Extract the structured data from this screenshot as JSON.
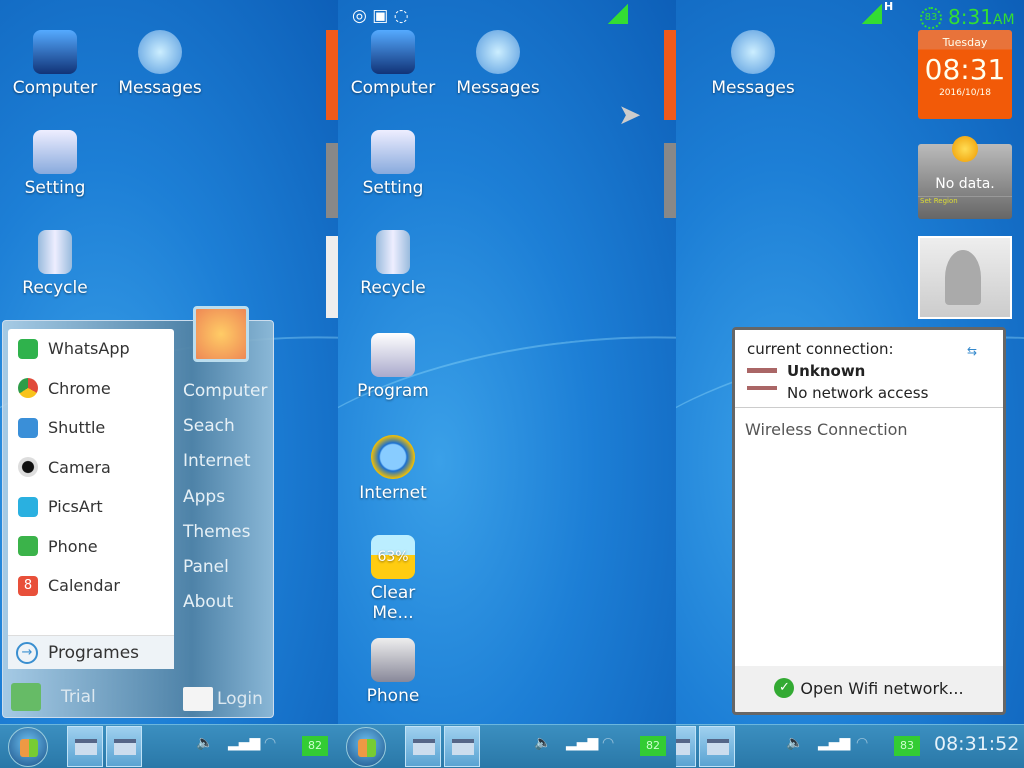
{
  "panel1": {
    "icons": [
      {
        "label": "Computer",
        "icon": "computer-icon"
      },
      {
        "label": "Messages",
        "icon": "chat-bubble-icon"
      },
      {
        "label": "Setting",
        "icon": "settings-icon"
      },
      {
        "label": "Recycle",
        "icon": "recycle-bin-icon"
      }
    ],
    "start_menu": {
      "apps": [
        {
          "label": "WhatsApp",
          "color": "#2fb24c"
        },
        {
          "label": "Chrome",
          "color": "#e04a3a"
        },
        {
          "label": "Shuttle",
          "color": "#3a8fd8"
        },
        {
          "label": "Camera",
          "color": "#333333"
        },
        {
          "label": "PicsArt",
          "color": "#2ab0e0"
        },
        {
          "label": "Phone",
          "color": "#3bb34a"
        },
        {
          "label": "Calendar",
          "color": "#e8503a"
        }
      ],
      "calendar_badge": "8",
      "programs": "Programes",
      "links": [
        "Computer",
        "Seach",
        "Internet",
        "Apps",
        "Themes",
        "Panel",
        "About"
      ],
      "user": "Trial",
      "login": "Login"
    }
  },
  "panel2": {
    "icons": [
      {
        "label": "Computer"
      },
      {
        "label": "Messages"
      },
      {
        "label": "Setting"
      },
      {
        "label": "Recycle"
      },
      {
        "label": "Program"
      },
      {
        "label": "Internet"
      },
      {
        "label": "Clear Me...",
        "badge": "63%"
      },
      {
        "label": "Phone"
      }
    ]
  },
  "panel3": {
    "status": {
      "network": "H",
      "battery": "83",
      "time": "8:31",
      "ampm": "AM"
    },
    "icons": [
      {
        "label": "Messages"
      }
    ],
    "clock_widget": {
      "day": "Tuesday",
      "time": "08:31",
      "date": "2016/10/18"
    },
    "weather_widget": {
      "text": "No data.",
      "link": "Set Region"
    },
    "connection": {
      "title": "current connection:",
      "name": "Unknown",
      "status": "No network access",
      "section": "Wireless Connection",
      "button": "Open Wifi network..."
    }
  },
  "taskbar": {
    "battery_left": "82",
    "battery_right": "83",
    "clock": "08:31:52"
  },
  "colors": {
    "accent": "#1d7fd6",
    "taskbar": "#2f80b0"
  }
}
